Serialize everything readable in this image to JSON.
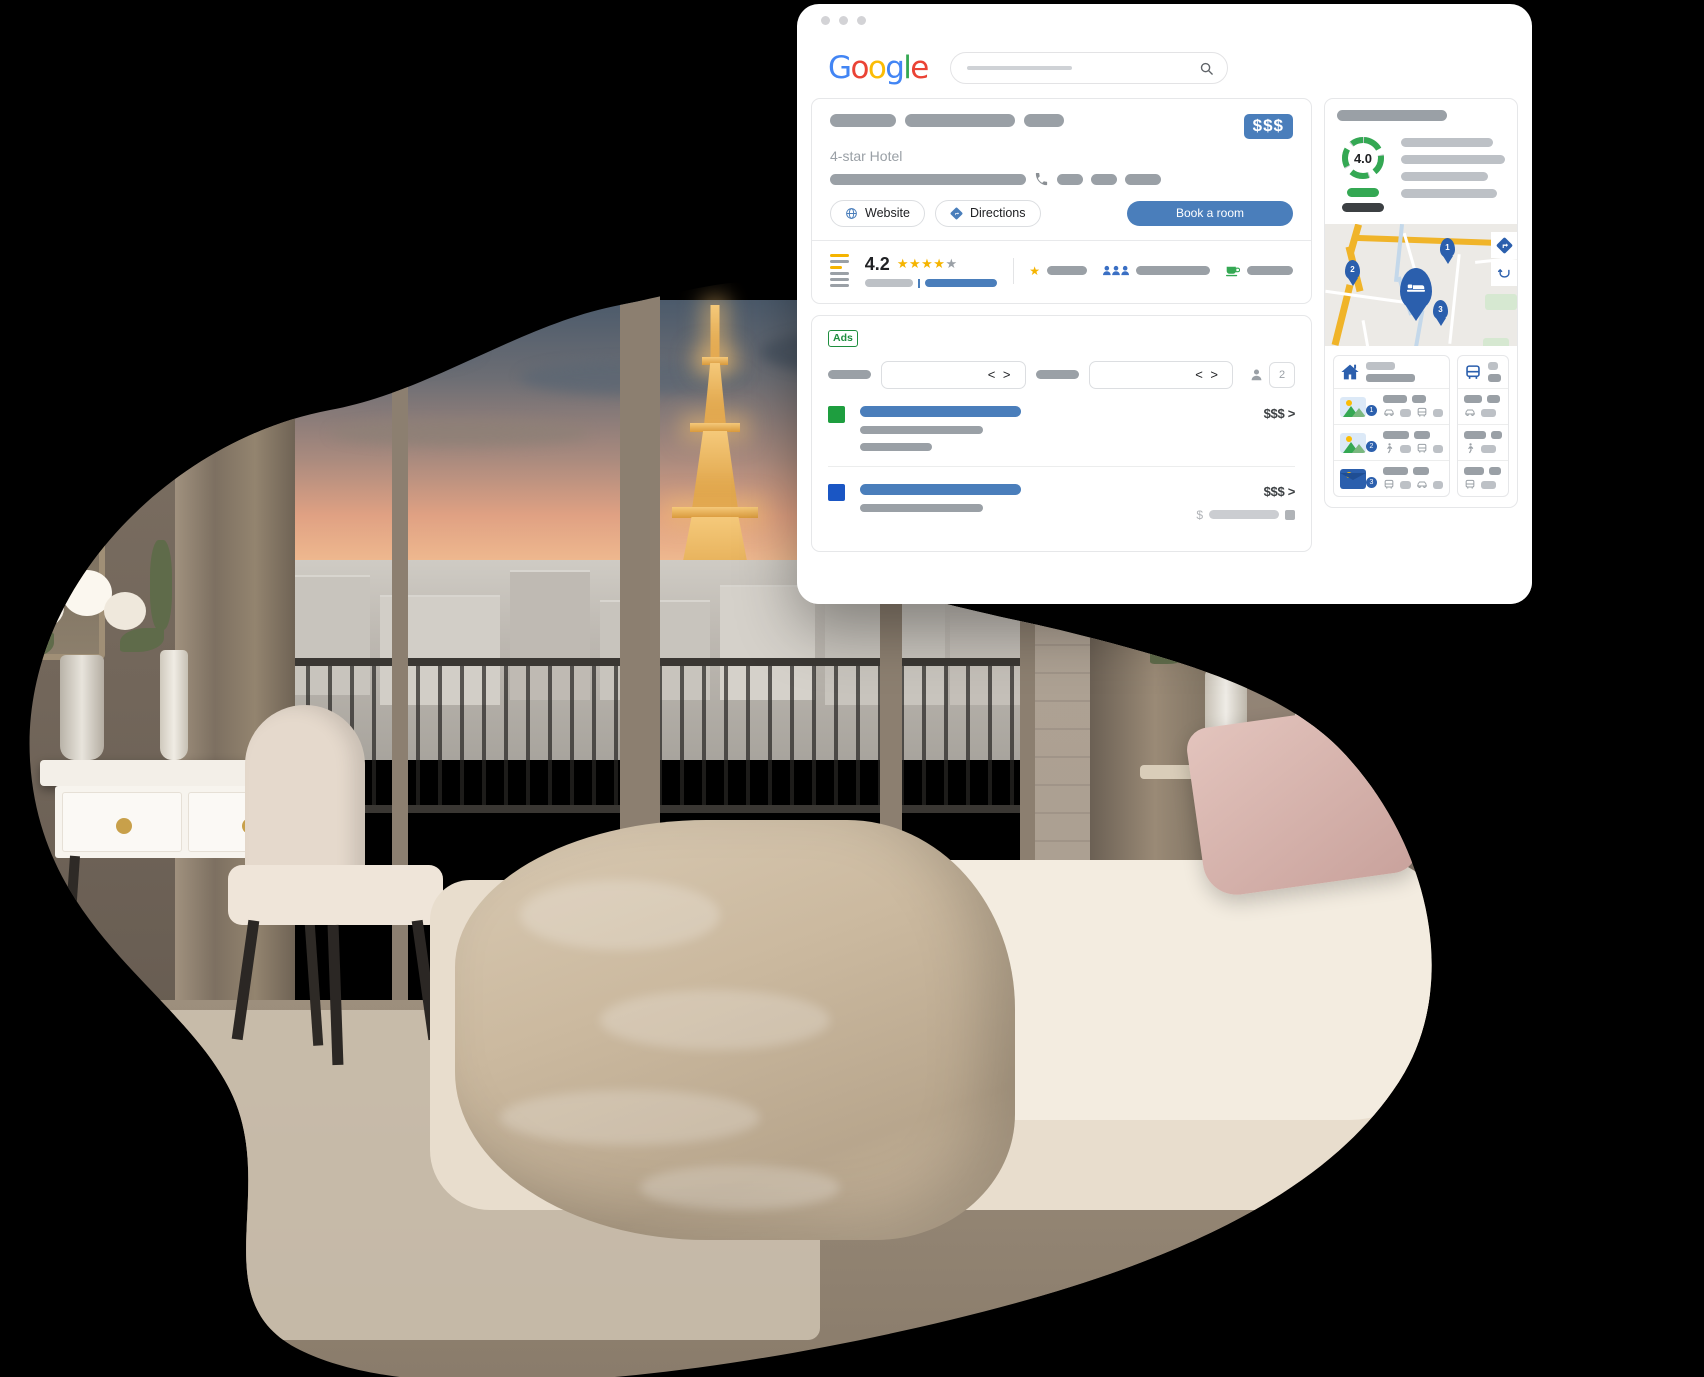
{
  "window": {
    "dots": [
      "dot-1",
      "dot-2",
      "dot-3"
    ]
  },
  "search": {
    "logo_letters": [
      "G",
      "o",
      "o",
      "g",
      "l",
      "e"
    ],
    "placeholder_label": "search-placeholder",
    "search_icon": "search-icon"
  },
  "knowledge_panel": {
    "title_placeholders": [
      "title-bar-1",
      "title-bar-2",
      "title-bar-3"
    ],
    "price_badge": "$$$",
    "subtitle": "4-star Hotel",
    "address_placeholder": "address-bar",
    "phone_icon": "phone-icon",
    "phone_placeholders": [
      "phone-part-1",
      "phone-part-2",
      "phone-part-3"
    ],
    "actions": {
      "website_label": "Website",
      "website_icon": "globe-icon",
      "directions_label": "Directions",
      "directions_icon": "directions-diamond-icon",
      "book_label": "Book a room"
    },
    "reviews": {
      "histogram_icon": "rating-histogram-icon",
      "score": "4.2",
      "stars_filled": 4,
      "stars_total": 5,
      "star_glyph": "★"
    },
    "amenities": [
      {
        "icon": "star-icon",
        "label_placeholder": "amenity-bar-1"
      },
      {
        "icon": "people-icon",
        "label_placeholder": "amenity-bar-2"
      },
      {
        "icon": "coffee-cup-icon",
        "label_placeholder": "amenity-bar-3"
      }
    ]
  },
  "ads_panel": {
    "tag": "Ads",
    "filters": {
      "checkin_label_placeholder": "checkin-label",
      "checkin_value": "< >",
      "checkout_label_placeholder": "checkout-label",
      "checkout_value": "< >",
      "guests_icon": "person-icon",
      "guests_count": "2"
    },
    "rows": [
      {
        "swatch_color": "#1e9e3f",
        "swatch_name": "advertiser-swatch-green",
        "title_placeholder": "ad-title-1",
        "line2_placeholder": "ad-desc-1",
        "line3_placeholder": "ad-desc-1b",
        "price": "$$$ >",
        "sub_price_symbol": "",
        "has_sub": false
      },
      {
        "swatch_color": "#1a56c4",
        "swatch_name": "advertiser-swatch-blue",
        "title_placeholder": "ad-title-2",
        "line2_placeholder": "ad-desc-2",
        "line3_placeholder": "ad-desc-2b",
        "price": "$$$ >",
        "sub_price_symbol": "$",
        "has_sub": true
      }
    ]
  },
  "right_panel": {
    "title_placeholder": "right-panel-title",
    "gauge": {
      "value": "4.0",
      "max": 5,
      "arc_color": "#34A853",
      "track_color": "#c9cdd1",
      "pill_green_name": "score-pill-green",
      "pill_dark_name": "score-pill-dark"
    },
    "detail_lines": [
      "detail-line-1",
      "detail-line-2",
      "detail-line-3",
      "detail-line-4"
    ],
    "map": {
      "hotel_pin_icon": "bed-pin-icon",
      "numbered_pins": [
        "1",
        "2",
        "3"
      ],
      "directions_button_icon": "directions-icon",
      "streetview_button_icon": "rotate-icon"
    },
    "places": {
      "columns": [
        {
          "header_icon": "home-icon",
          "rows": [
            {
              "thumb": "photo-thumb-green",
              "badge": "1",
              "icons": [
                "car-icon",
                "bus-icon"
              ]
            },
            {
              "thumb": "photo-thumb-green",
              "badge": "2",
              "icons": [
                "walk-icon",
                "bus-icon"
              ]
            },
            {
              "thumb": "photo-thumb-blue",
              "badge": "3",
              "icons": [
                "bus-icon",
                "car-icon"
              ]
            }
          ]
        },
        {
          "header_icon": "bus-icon",
          "rows": [
            {
              "thumb": "",
              "badge": "",
              "icons": [
                "car-icon"
              ]
            },
            {
              "thumb": "",
              "badge": "",
              "icons": [
                "walk-icon"
              ]
            },
            {
              "thumb": "",
              "badge": "",
              "icons": [
                "bus-icon"
              ]
            }
          ]
        }
      ]
    }
  },
  "photo": {
    "alt_name": "paris-hotel-room-with-eiffel-tower-view",
    "landmark": "Eiffel Tower"
  },
  "colors": {
    "google_blue": "#4285F4",
    "google_red": "#EA4335",
    "google_yellow": "#FBBC05",
    "google_green": "#34A853",
    "accent_blue": "#4a7ebb",
    "map_road": "#f0b429",
    "star_gold": "#f5b400"
  }
}
